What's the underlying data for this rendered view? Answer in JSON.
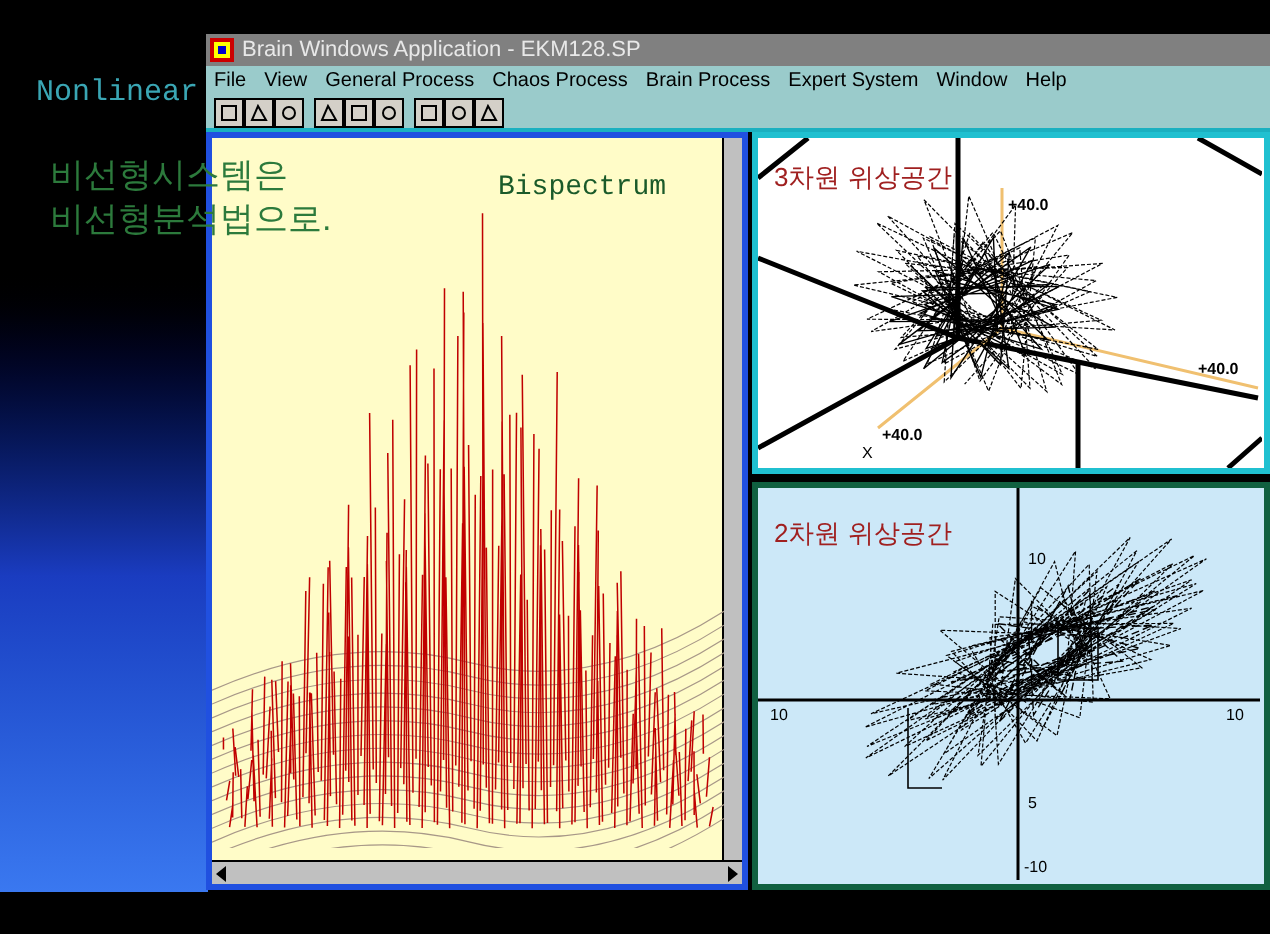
{
  "slide": {
    "heading": "Nonlinear",
    "lines": [
      "비선형시스템은",
      "비선형분석법으로."
    ]
  },
  "window": {
    "title": "Brain Windows Application - EKM128.SP"
  },
  "menu": [
    "File",
    "View",
    "General Process",
    "Chaos Process",
    "Brain Process",
    "Expert System",
    "Window",
    "Help"
  ],
  "bispectrum": {
    "label": "Bispectrum"
  },
  "phase_3d": {
    "title": "3차원 위상공간",
    "axis_labels": [
      "+40.0",
      "+40.0",
      "+40.0",
      "X"
    ]
  },
  "phase_2d": {
    "title": "2차원 위상공간",
    "y_ticks": [
      "10",
      "5",
      "-10"
    ],
    "x_ticks": [
      "10",
      "10"
    ]
  }
}
